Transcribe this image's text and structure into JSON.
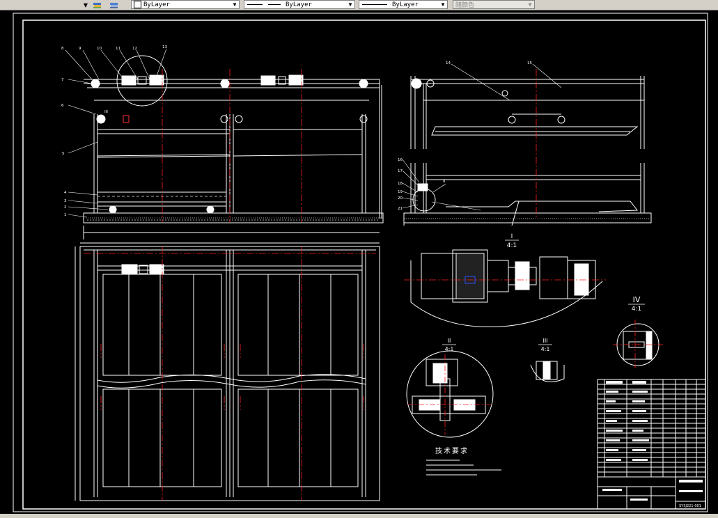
{
  "toolbar": {
    "layer_value": "ByLayer",
    "linetype_value": "ByLayer",
    "lineweight_value": "ByLayer",
    "color_value": "随颜色"
  },
  "drawing": {
    "detail_I_label": "I",
    "detail_I_scale": "4:1",
    "detail_II_label": "II",
    "detail_II_scale": "4:1",
    "detail_III_label": "III",
    "detail_III_scale": "4:1",
    "detail_IV_label": "IV",
    "detail_IV_scale": "4:1",
    "tech_title": "技术要求",
    "drawing_number": "SYSJ221-001",
    "callouts_left": [
      "1",
      "2",
      "3",
      "4",
      "5",
      "6",
      "7",
      "8",
      "9",
      "10",
      "11",
      "12",
      "13"
    ],
    "callouts_right": [
      "14",
      "15",
      "16",
      "17",
      "18",
      "19",
      "20",
      "21"
    ],
    "callout_right_II": "II",
    "callout_left_III": "III"
  }
}
